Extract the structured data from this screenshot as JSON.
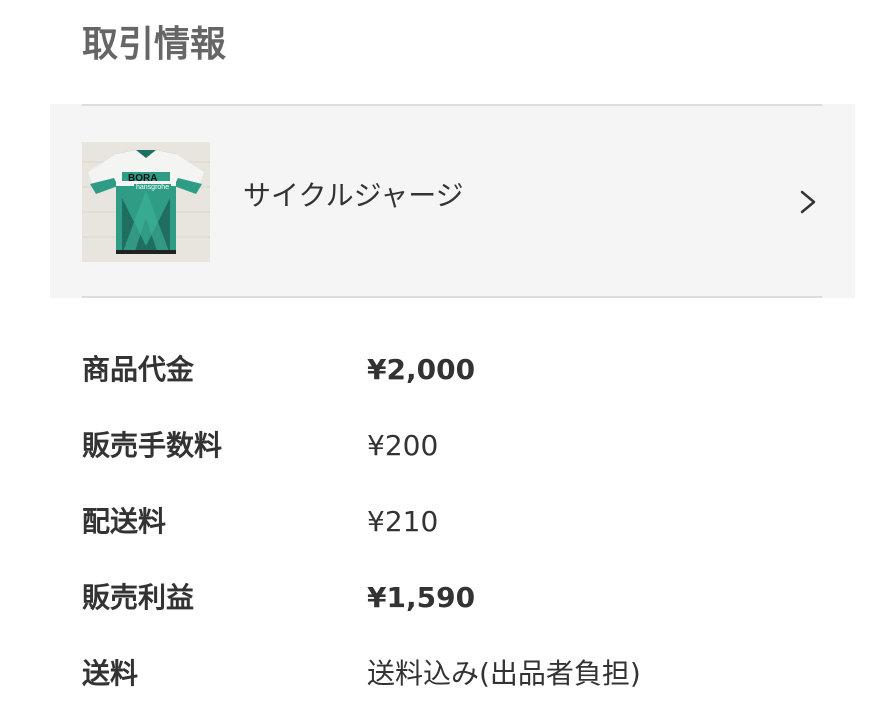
{
  "section": {
    "title": "取引情報"
  },
  "item": {
    "name": "サイクルジャージ",
    "thumbnail_icon": "jersey-image",
    "thumbnail_text": {
      "brand": "BORA",
      "sub": "hansgrohe"
    },
    "chevron_icon": "chevron-right-icon"
  },
  "fees": [
    {
      "label": "商品代金",
      "value": "¥2,000",
      "bold": true
    },
    {
      "label": "販売手数料",
      "value": "¥200",
      "bold": false
    },
    {
      "label": "配送料",
      "value": "¥210",
      "bold": false
    },
    {
      "label": "販売利益",
      "value": "¥1,590",
      "bold": true
    },
    {
      "label": "送料",
      "value": "送料込み(出品者負担)",
      "bold": false
    }
  ],
  "colors": {
    "title": "#666666",
    "text": "#333333",
    "card_bg": "#f5f5f5",
    "divider": "#dddddd",
    "jersey_green": "#2f9d86",
    "jersey_dark": "#1f6e60"
  }
}
